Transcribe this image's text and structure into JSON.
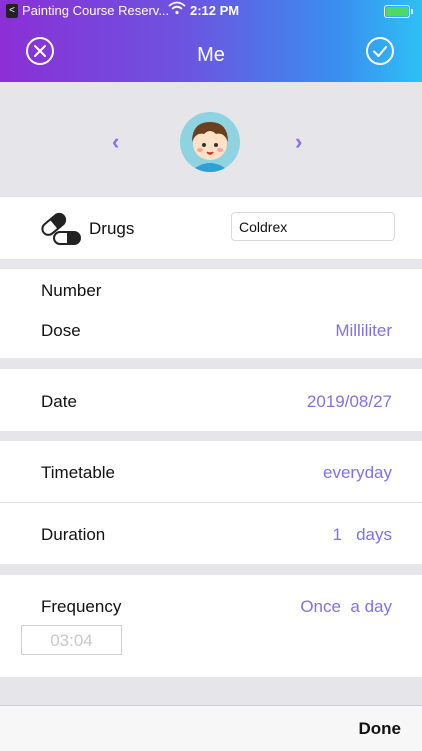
{
  "status_bar": {
    "back_glyph": "<",
    "app": "Painting Course Reserv...",
    "wifi_icon": "wifi-icon",
    "time": "2:12 PM",
    "battery_icon": "battery-icon"
  },
  "header": {
    "title": "Me",
    "close_icon": "close-icon",
    "check_icon": "check-icon"
  },
  "avatar": {
    "prev_glyph": "‹",
    "next_glyph": "›",
    "image_icon": "avatar-boy-icon"
  },
  "drug": {
    "icon": "pill-icon",
    "label": "Drugs",
    "value": "Coldrex"
  },
  "number": {
    "label": "Number"
  },
  "dose": {
    "label": "Dose",
    "value": "Milliliter"
  },
  "date": {
    "label": "Date",
    "value": "2019/08/27"
  },
  "timetable": {
    "label": "Timetable",
    "value": "everyday"
  },
  "duration": {
    "label": "Duration",
    "value": "1   days"
  },
  "frequency": {
    "label": "Frequency",
    "value": "Once  a day"
  },
  "time_slot": {
    "value": "03:04"
  },
  "toolbar": {
    "done_label": "Done"
  },
  "colors": {
    "accent": "#7f72e6",
    "header_gradient_start": "#8b2fd6",
    "header_gradient_end": "#2ec0f5"
  }
}
